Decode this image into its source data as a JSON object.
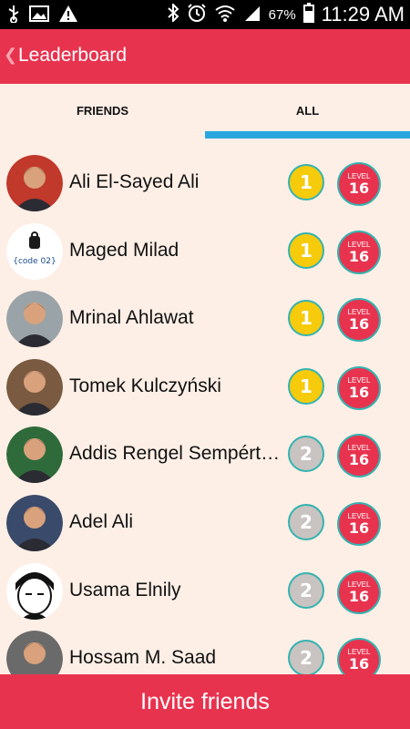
{
  "status_bar": {
    "left_icons": [
      "usb-icon",
      "image-icon",
      "warning-icon"
    ],
    "right_icons": [
      "bluetooth-icon",
      "alarm-icon",
      "wifi-icon",
      "signal-icon",
      "battery-icon"
    ],
    "battery_percent": "67%",
    "time": "11:29 AM"
  },
  "app_bar": {
    "title": "Leaderboard",
    "back_icon": "chevron-left-icon"
  },
  "tabs": {
    "friends": "FRIENDS",
    "all": "ALL",
    "selected": "ALL"
  },
  "level_label": "LEVEL",
  "players": [
    {
      "name": "Ali El-Sayed Ali",
      "rank": "1",
      "rank_color": "gold",
      "level": "16",
      "avatar": "photo"
    },
    {
      "name": "Maged Milad",
      "rank": "1",
      "rank_color": "gold",
      "level": "16",
      "avatar": "code-logo"
    },
    {
      "name": "Mrinal Ahlawat",
      "rank": "1",
      "rank_color": "gold",
      "level": "16",
      "avatar": "photo"
    },
    {
      "name": "Tomek Kulczyński",
      "rank": "1",
      "rank_color": "gold",
      "level": "16",
      "avatar": "photo"
    },
    {
      "name": "Addis Rengel Sempértegui",
      "rank": "2",
      "rank_color": "silver",
      "level": "16",
      "avatar": "photo"
    },
    {
      "name": "Adel Ali",
      "rank": "2",
      "rank_color": "silver",
      "level": "16",
      "avatar": "photo"
    },
    {
      "name": "Usama Elnily",
      "rank": "2",
      "rank_color": "silver",
      "level": "16",
      "avatar": "cartoon"
    },
    {
      "name": "Hossam M. Saad",
      "rank": "2",
      "rank_color": "silver",
      "level": "16",
      "avatar": "photo"
    }
  ],
  "avatar_logo_text": "{code 02}",
  "invite_button": "Invite friends",
  "colors": {
    "primary": "#e8334f",
    "tab_indicator": "#2aa6df",
    "background": "#fdefe6",
    "gold": "#f6cb0c",
    "silver": "#c9c4c1",
    "ring": "#35b3b0"
  }
}
